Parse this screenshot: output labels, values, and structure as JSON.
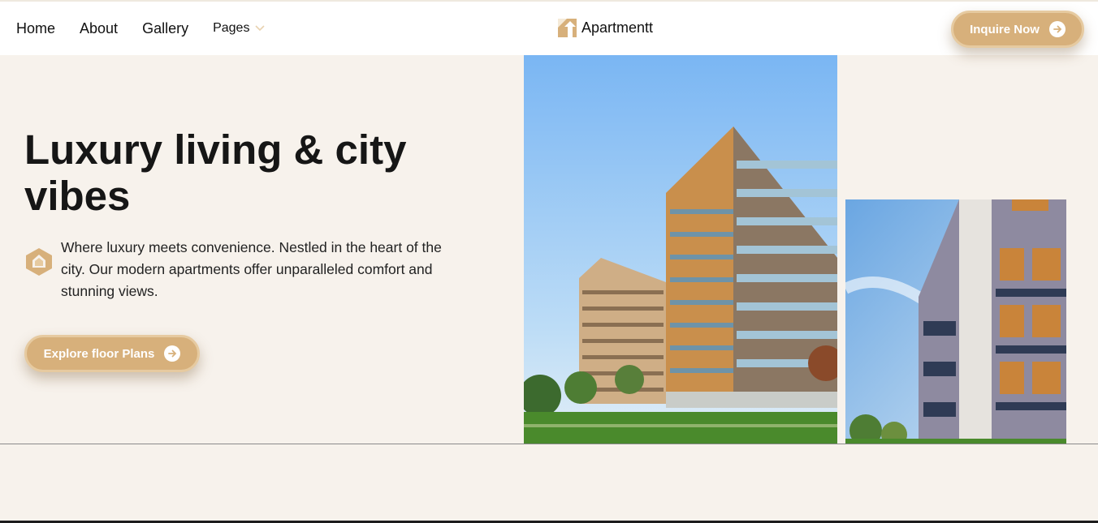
{
  "nav": {
    "home": "Home",
    "about": "About",
    "gallery": "Gallery",
    "pages": "Pages"
  },
  "brand": {
    "name": "Apartmentt"
  },
  "header": {
    "cta_label": "Inquire Now"
  },
  "hero": {
    "title": "Luxury living & city vibes",
    "description": "Where luxury meets convenience. Nestled in the heart of the city. Our modern apartments offer unparalleled comfort and stunning views.",
    "cta_label": "Explore floor Plans"
  },
  "colors": {
    "accent": "#d7b07b",
    "background": "#f7f2ec",
    "header_bg": "#ffffff"
  },
  "icons": {
    "logo": "building-logo-icon",
    "pages_dropdown": "chevron-down-icon",
    "cta_arrow": "arrow-right-circle-icon",
    "hero_badge": "house-badge-icon"
  }
}
